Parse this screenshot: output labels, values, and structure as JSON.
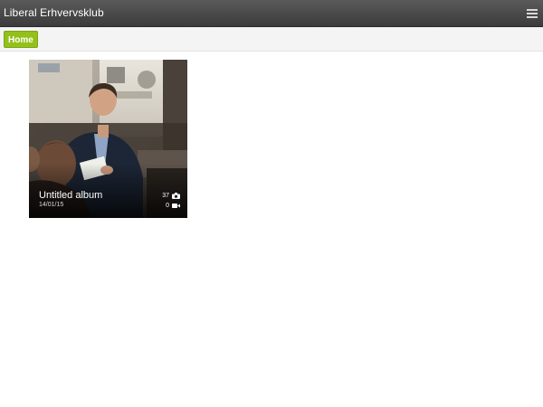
{
  "header": {
    "site_title": "Liberal Erhvervsklub",
    "menu_icon": "hamburger-menu-icon"
  },
  "nav": {
    "home_label": "Home",
    "accent_color": "#94c01a"
  },
  "albums": [
    {
      "title": "Untitled album",
      "date": "14/01/15",
      "photo_count": "37",
      "video_count": "0",
      "photo_icon": "camera-icon",
      "video_icon": "video-camera-icon"
    }
  ]
}
